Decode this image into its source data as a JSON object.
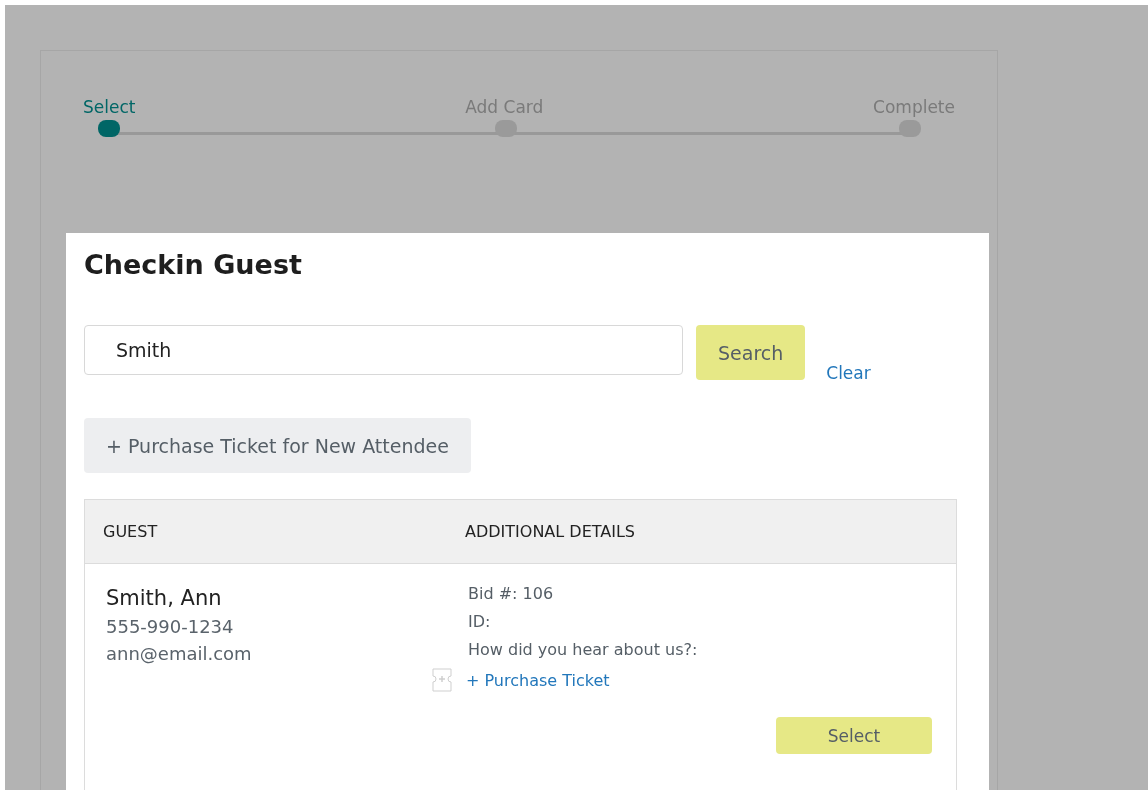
{
  "stepper": [
    {
      "label": "Select",
      "selected": true
    },
    {
      "label": "Add Card",
      "selected": false
    },
    {
      "label": "Complete",
      "selected": false
    }
  ],
  "dialog": {
    "title": "Checkin Guest",
    "search": {
      "value": "Smith",
      "button": "Search",
      "clear": "Clear"
    },
    "new_attendee_button": "+ Purchase Ticket for New Attendee",
    "table": {
      "columns": [
        "GUEST",
        "ADDITIONAL DETAILS"
      ],
      "rows": [
        {
          "name": "Smith, Ann",
          "phone": "555-990-1234",
          "email": "ann@email.com",
          "details": [
            "Bid #: 106",
            "ID:",
            "How did you hear about us?:"
          ],
          "purchase_link": "+ Purchase Ticket",
          "action": "Select"
        }
      ]
    }
  }
}
